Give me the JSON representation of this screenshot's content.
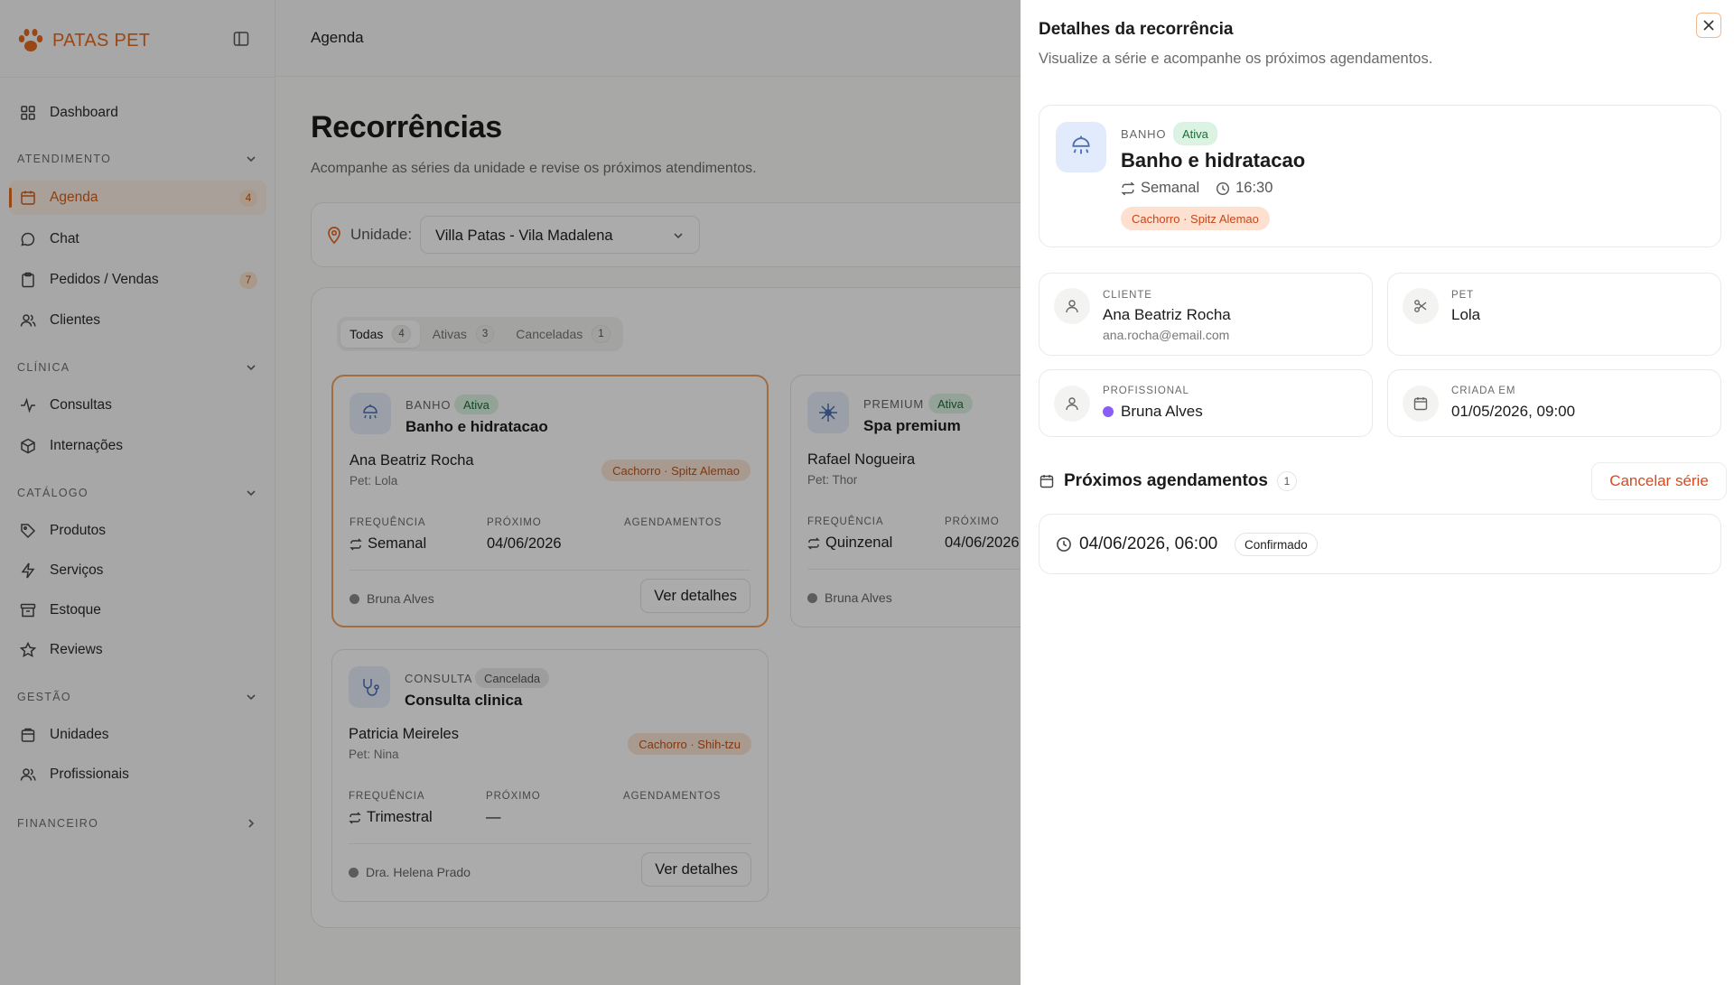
{
  "brand": {
    "name": "PATAS PET",
    "color": "#e46a22"
  },
  "sidebar": {
    "dashboard": "Dashboard",
    "sections": {
      "atendimento": "ATENDIMENTO",
      "clinica": "CLÍNICA",
      "catalogo": "CATÁLOGO",
      "gestao": "GESTÃO",
      "financeiro": "FINANCEIRO"
    },
    "items": {
      "agenda": {
        "label": "Agenda",
        "badge": "4"
      },
      "chat": {
        "label": "Chat"
      },
      "pedidos": {
        "label": "Pedidos / Vendas",
        "badge": "7"
      },
      "clientes": {
        "label": "Clientes"
      },
      "consultas": {
        "label": "Consultas"
      },
      "internacoes": {
        "label": "Internações"
      },
      "produtos": {
        "label": "Produtos"
      },
      "servicos": {
        "label": "Serviços"
      },
      "estoque": {
        "label": "Estoque"
      },
      "reviews": {
        "label": "Reviews"
      },
      "unidades": {
        "label": "Unidades"
      },
      "profissionais": {
        "label": "Profissionais"
      }
    }
  },
  "topbar": {
    "title": "Agenda"
  },
  "page": {
    "title": "Recorrências",
    "subtitle": "Acompanhe as séries da unidade e revise os próximos atendimentos."
  },
  "filter": {
    "label": "Unidade:",
    "value": "Villa Patas - Vila Madalena"
  },
  "tabs": [
    {
      "label": "Todas",
      "count": "4"
    },
    {
      "label": "Ativas",
      "count": "3"
    },
    {
      "label": "Canceladas",
      "count": "1"
    }
  ],
  "labels": {
    "frequencia": "FREQUÊNCIA",
    "proximo": "PRÓXIMO",
    "agendamentos": "AGENDAMENTOS",
    "ver_detalhes": "Ver detalhes"
  },
  "cards": [
    {
      "category": "BANHO",
      "status": "Ativa",
      "title": "Banho e hidratacao",
      "client": "Ana Beatriz Rocha",
      "pet": "Pet: Lola",
      "breed": "Cachorro · Spitz Alemao",
      "frequency": "Semanal",
      "next": "04/06/2026",
      "professional": "Bruna Alves"
    },
    {
      "category": "PREMIUM",
      "status": "Ativa",
      "title": "Spa premium",
      "client": "Rafael Nogueira",
      "pet": "Pet: Thor",
      "breed": "",
      "frequency": "Quinzenal",
      "next": "04/06/2026",
      "professional": "Bruna Alves"
    },
    {
      "category": "CONSULTA",
      "status": "Cancelada",
      "title": "Consulta clinica",
      "client": "Patricia Meireles",
      "pet": "Pet: Nina",
      "breed": "Cachorro · Shih-tzu",
      "frequency": "Trimestral",
      "next": "—",
      "professional": "Dra. Helena Prado"
    }
  ],
  "drawer": {
    "title": "Detalhes da recorrência",
    "subtitle": "Visualize a série e acompanhe os próximos agendamentos.",
    "hero": {
      "category": "BANHO",
      "status": "Ativa",
      "title": "Banho e hidratacao",
      "frequency": "Semanal",
      "time": "16:30",
      "breed": "Cachorro · Spitz Alemao"
    },
    "cliente": {
      "label": "CLIENTE",
      "name": "Ana Beatriz Rocha",
      "email": "ana.rocha@email.com"
    },
    "pet": {
      "label": "PET",
      "name": "Lola"
    },
    "profissional": {
      "label": "PROFISSIONAL",
      "name": "Bruna Alves",
      "color": "#8b5cf6"
    },
    "criada": {
      "label": "CRIADA EM",
      "value": "01/05/2026, 09:00"
    },
    "schedule": {
      "title": "Próximos agendamentos",
      "count": "1",
      "cancel_label": "Cancelar série"
    },
    "appointments": [
      {
        "datetime": "04/06/2026, 06:00",
        "status": "Confirmado"
      }
    ]
  }
}
